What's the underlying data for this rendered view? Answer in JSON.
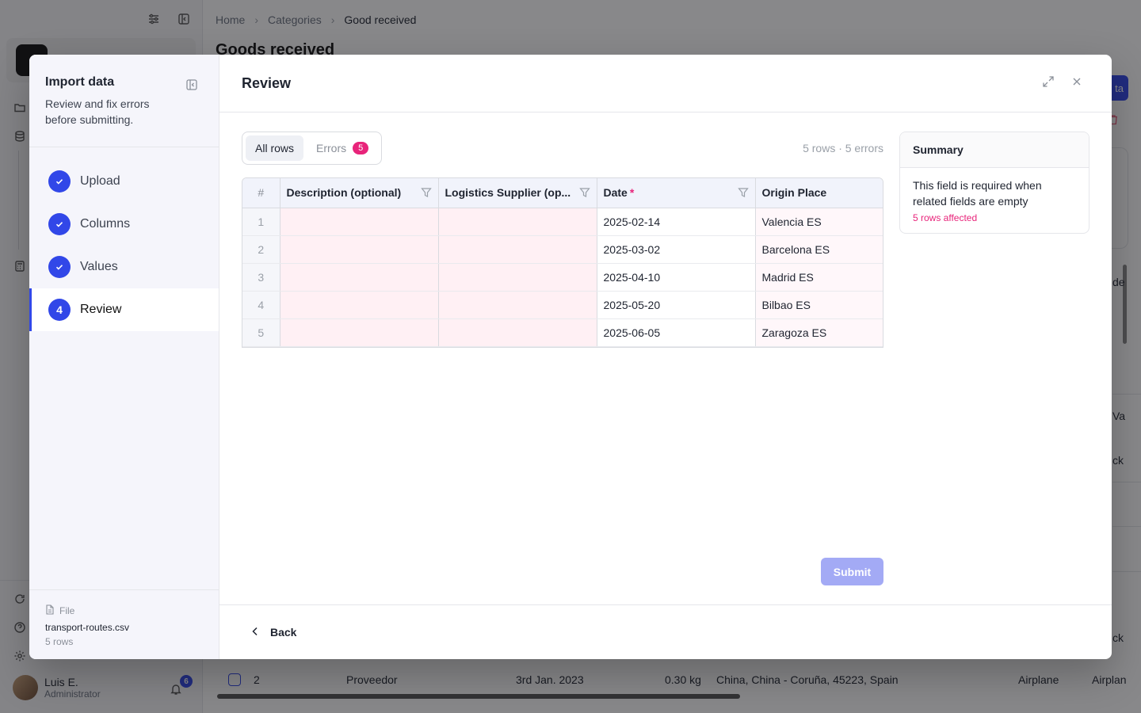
{
  "background": {
    "breadcrumb": [
      "Home",
      "Categories",
      "Good received"
    ],
    "page_title": "Goods received",
    "button_fragment": "ta",
    "fragments": [
      "de",
      "Va",
      "ck",
      "ck"
    ],
    "user": {
      "name": "Luis E.",
      "role": "Administrator",
      "notifications": "6"
    },
    "visible_row": {
      "index": "2",
      "type": "Proveedor",
      "date": "3rd Jan. 2023",
      "weight": "0.30 kg",
      "route": "China, China - Coruña, 45223, Spain",
      "transport": "Airplane",
      "transport2": "Airplan"
    }
  },
  "wizard": {
    "title": "Import data",
    "subtitle": "Review and fix errors before submitting.",
    "steps": [
      {
        "label": "Upload",
        "state": "done"
      },
      {
        "label": "Columns",
        "state": "done"
      },
      {
        "label": "Values",
        "state": "done"
      },
      {
        "label": "Review",
        "state": "active",
        "number": "4"
      }
    ],
    "file": {
      "label": "File",
      "name": "transport-routes.csv",
      "rows": "5 rows"
    }
  },
  "review": {
    "title": "Review",
    "tabs": {
      "all": "All rows",
      "errors": "Errors",
      "error_count": "5"
    },
    "row_summary": "5 rows · 5 errors",
    "columns": [
      "#",
      "Description (optional)",
      "Logistics Supplier (op...",
      "Date",
      "Origin Place"
    ],
    "rows": [
      {
        "n": "1",
        "description": "",
        "supplier": "",
        "date": "2025-02-14",
        "origin": "Valencia ES"
      },
      {
        "n": "2",
        "description": "",
        "supplier": "",
        "date": "2025-03-02",
        "origin": "Barcelona ES"
      },
      {
        "n": "3",
        "description": "",
        "supplier": "",
        "date": "2025-04-10",
        "origin": "Madrid ES"
      },
      {
        "n": "4",
        "description": "",
        "supplier": "",
        "date": "2025-05-20",
        "origin": "Bilbao ES"
      },
      {
        "n": "5",
        "description": "",
        "supplier": "",
        "date": "2025-06-05",
        "origin": "Zaragoza ES"
      }
    ],
    "summary": {
      "title": "Summary",
      "message": "This field is required when related fields are empty",
      "affected": "5 rows affected"
    },
    "submit_label": "Submit",
    "back_label": "Back"
  },
  "colors": {
    "accent": "#3147e8",
    "error": "#e8247a",
    "error_bg": "#fff0f4"
  }
}
